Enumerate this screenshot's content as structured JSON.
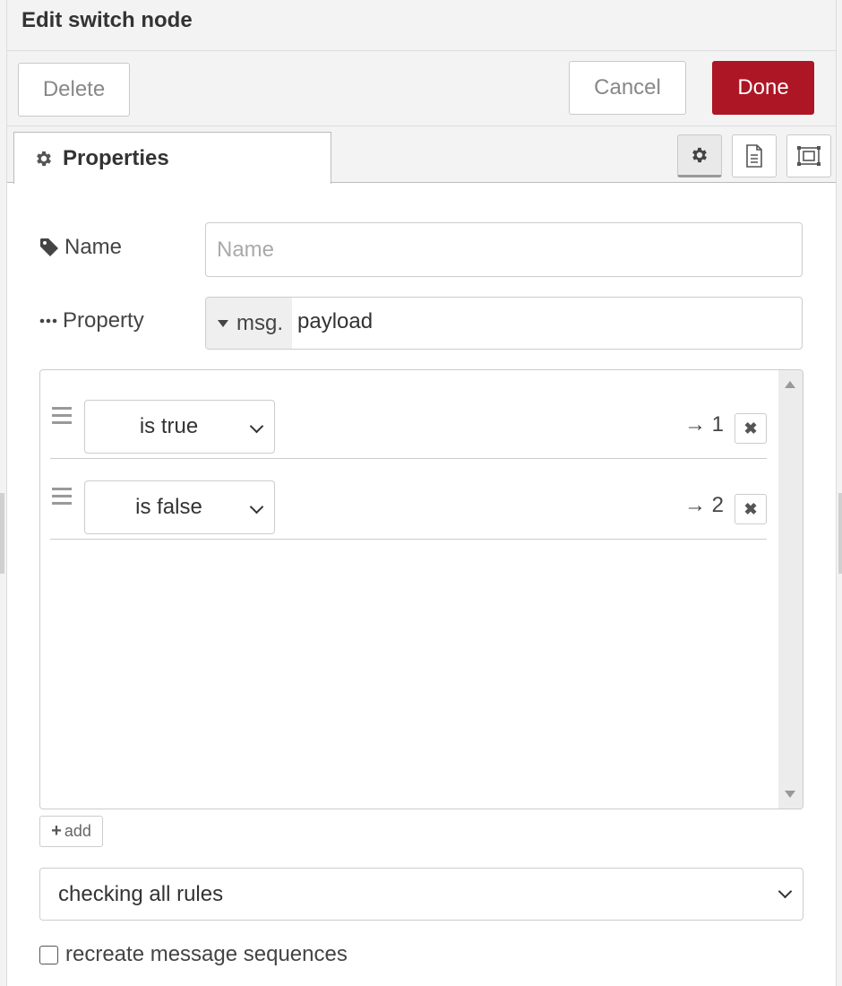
{
  "dialog": {
    "title": "Edit switch node"
  },
  "toolbar": {
    "delete_label": "Delete",
    "cancel_label": "Cancel",
    "done_label": "Done"
  },
  "tabs": {
    "active_label": "Properties",
    "icons": [
      "gear-icon",
      "description-icon",
      "appearance-icon"
    ]
  },
  "form": {
    "name_label": "Name",
    "name_placeholder": "Name",
    "name_value": "",
    "property_label": "Property",
    "property_type": "msg.",
    "property_value": "payload"
  },
  "rules": [
    {
      "condition": "is true",
      "output": "→ 1"
    },
    {
      "condition": "is false",
      "output": "→ 2"
    }
  ],
  "add_label": "add",
  "mode": {
    "selected": "checking all rules"
  },
  "recreate_sequences": {
    "label": "recreate message sequences",
    "checked": false
  },
  "colors": {
    "primary": "#ad1625",
    "panel": "#f3f3f3",
    "border": "#cccccc"
  }
}
